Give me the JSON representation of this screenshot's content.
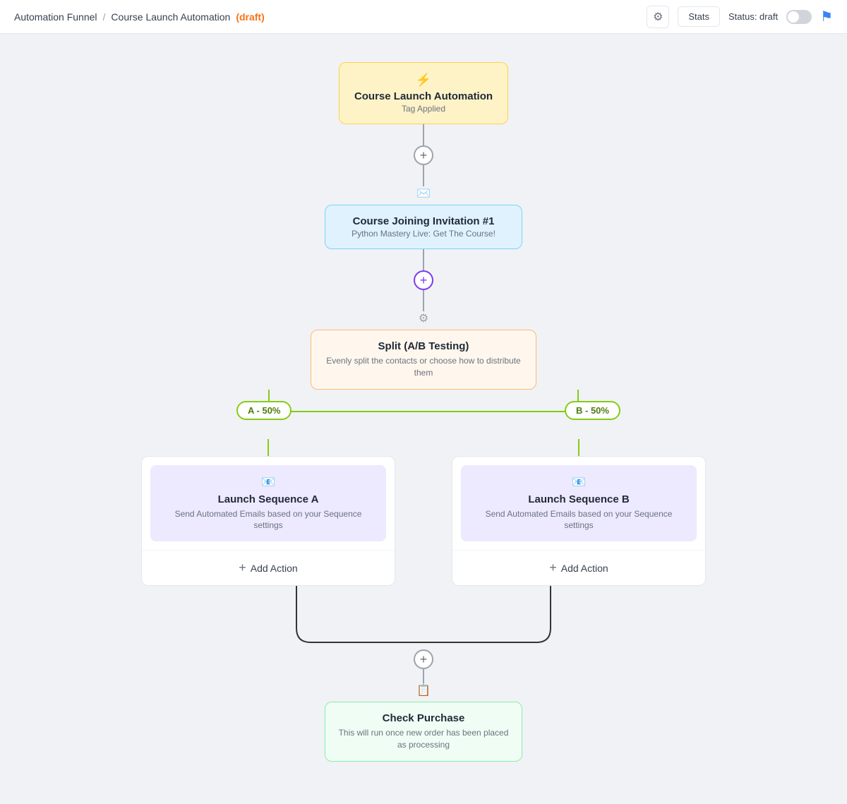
{
  "header": {
    "breadcrumb_parent": "Automation Funnel",
    "breadcrumb_sep": "/",
    "breadcrumb_current": "Course Launch Automation",
    "breadcrumb_draft": "(draft)",
    "stats_label": "Stats",
    "status_label": "Status: draft",
    "toggle_state": false
  },
  "nodes": {
    "trigger": {
      "icon": "⚡",
      "title": "Course Launch Automation",
      "subtitle": "Tag Applied"
    },
    "email": {
      "icon": "✉",
      "title": "Course Joining Invitation #1",
      "subtitle": "Python Mastery Live: Get The Course!"
    },
    "split": {
      "icon": "⚙",
      "title": "Split (A/B Testing)",
      "subtitle": "Evenly split the contacts or choose how to distribute them"
    },
    "branch_a": {
      "label": "A - 50%"
    },
    "branch_b": {
      "label": "B - 50%"
    },
    "sequence_a": {
      "icon": "📧",
      "title": "Launch Sequence A",
      "subtitle": "Send Automated Emails based on your Sequence settings"
    },
    "sequence_b": {
      "icon": "📧",
      "title": "Launch Sequence B",
      "subtitle": "Send Automated Emails based on your Sequence settings"
    },
    "add_action_a": "Add Action",
    "add_action_b": "Add Action",
    "check": {
      "icon": "📋",
      "title": "Check Purchase",
      "subtitle": "This will run once new order has been placed as processing"
    }
  },
  "icons": {
    "gear": "⚙",
    "flag": "⚑",
    "plus": "+",
    "sequence": "📧",
    "trigger": "⚡",
    "split": "⚙",
    "check": "📋"
  }
}
